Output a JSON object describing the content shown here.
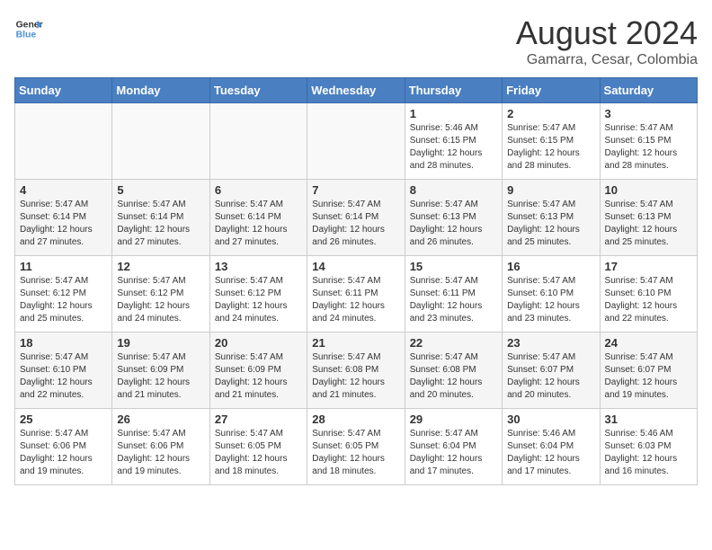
{
  "header": {
    "logo_line1": "General",
    "logo_line2": "Blue",
    "title": "August 2024",
    "subtitle": "Gamarra, Cesar, Colombia"
  },
  "weekdays": [
    "Sunday",
    "Monday",
    "Tuesday",
    "Wednesday",
    "Thursday",
    "Friday",
    "Saturday"
  ],
  "weeks": [
    [
      {
        "day": "",
        "detail": ""
      },
      {
        "day": "",
        "detail": ""
      },
      {
        "day": "",
        "detail": ""
      },
      {
        "day": "",
        "detail": ""
      },
      {
        "day": "1",
        "detail": "Sunrise: 5:46 AM\nSunset: 6:15 PM\nDaylight: 12 hours\nand 28 minutes."
      },
      {
        "day": "2",
        "detail": "Sunrise: 5:47 AM\nSunset: 6:15 PM\nDaylight: 12 hours\nand 28 minutes."
      },
      {
        "day": "3",
        "detail": "Sunrise: 5:47 AM\nSunset: 6:15 PM\nDaylight: 12 hours\nand 28 minutes."
      }
    ],
    [
      {
        "day": "4",
        "detail": "Sunrise: 5:47 AM\nSunset: 6:14 PM\nDaylight: 12 hours\nand 27 minutes."
      },
      {
        "day": "5",
        "detail": "Sunrise: 5:47 AM\nSunset: 6:14 PM\nDaylight: 12 hours\nand 27 minutes."
      },
      {
        "day": "6",
        "detail": "Sunrise: 5:47 AM\nSunset: 6:14 PM\nDaylight: 12 hours\nand 27 minutes."
      },
      {
        "day": "7",
        "detail": "Sunrise: 5:47 AM\nSunset: 6:14 PM\nDaylight: 12 hours\nand 26 minutes."
      },
      {
        "day": "8",
        "detail": "Sunrise: 5:47 AM\nSunset: 6:13 PM\nDaylight: 12 hours\nand 26 minutes."
      },
      {
        "day": "9",
        "detail": "Sunrise: 5:47 AM\nSunset: 6:13 PM\nDaylight: 12 hours\nand 25 minutes."
      },
      {
        "day": "10",
        "detail": "Sunrise: 5:47 AM\nSunset: 6:13 PM\nDaylight: 12 hours\nand 25 minutes."
      }
    ],
    [
      {
        "day": "11",
        "detail": "Sunrise: 5:47 AM\nSunset: 6:12 PM\nDaylight: 12 hours\nand 25 minutes."
      },
      {
        "day": "12",
        "detail": "Sunrise: 5:47 AM\nSunset: 6:12 PM\nDaylight: 12 hours\nand 24 minutes."
      },
      {
        "day": "13",
        "detail": "Sunrise: 5:47 AM\nSunset: 6:12 PM\nDaylight: 12 hours\nand 24 minutes."
      },
      {
        "day": "14",
        "detail": "Sunrise: 5:47 AM\nSunset: 6:11 PM\nDaylight: 12 hours\nand 24 minutes."
      },
      {
        "day": "15",
        "detail": "Sunrise: 5:47 AM\nSunset: 6:11 PM\nDaylight: 12 hours\nand 23 minutes."
      },
      {
        "day": "16",
        "detail": "Sunrise: 5:47 AM\nSunset: 6:10 PM\nDaylight: 12 hours\nand 23 minutes."
      },
      {
        "day": "17",
        "detail": "Sunrise: 5:47 AM\nSunset: 6:10 PM\nDaylight: 12 hours\nand 22 minutes."
      }
    ],
    [
      {
        "day": "18",
        "detail": "Sunrise: 5:47 AM\nSunset: 6:10 PM\nDaylight: 12 hours\nand 22 minutes."
      },
      {
        "day": "19",
        "detail": "Sunrise: 5:47 AM\nSunset: 6:09 PM\nDaylight: 12 hours\nand 21 minutes."
      },
      {
        "day": "20",
        "detail": "Sunrise: 5:47 AM\nSunset: 6:09 PM\nDaylight: 12 hours\nand 21 minutes."
      },
      {
        "day": "21",
        "detail": "Sunrise: 5:47 AM\nSunset: 6:08 PM\nDaylight: 12 hours\nand 21 minutes."
      },
      {
        "day": "22",
        "detail": "Sunrise: 5:47 AM\nSunset: 6:08 PM\nDaylight: 12 hours\nand 20 minutes."
      },
      {
        "day": "23",
        "detail": "Sunrise: 5:47 AM\nSunset: 6:07 PM\nDaylight: 12 hours\nand 20 minutes."
      },
      {
        "day": "24",
        "detail": "Sunrise: 5:47 AM\nSunset: 6:07 PM\nDaylight: 12 hours\nand 19 minutes."
      }
    ],
    [
      {
        "day": "25",
        "detail": "Sunrise: 5:47 AM\nSunset: 6:06 PM\nDaylight: 12 hours\nand 19 minutes."
      },
      {
        "day": "26",
        "detail": "Sunrise: 5:47 AM\nSunset: 6:06 PM\nDaylight: 12 hours\nand 19 minutes."
      },
      {
        "day": "27",
        "detail": "Sunrise: 5:47 AM\nSunset: 6:05 PM\nDaylight: 12 hours\nand 18 minutes."
      },
      {
        "day": "28",
        "detail": "Sunrise: 5:47 AM\nSunset: 6:05 PM\nDaylight: 12 hours\nand 18 minutes."
      },
      {
        "day": "29",
        "detail": "Sunrise: 5:47 AM\nSunset: 6:04 PM\nDaylight: 12 hours\nand 17 minutes."
      },
      {
        "day": "30",
        "detail": "Sunrise: 5:46 AM\nSunset: 6:04 PM\nDaylight: 12 hours\nand 17 minutes."
      },
      {
        "day": "31",
        "detail": "Sunrise: 5:46 AM\nSunset: 6:03 PM\nDaylight: 12 hours\nand 16 minutes."
      }
    ]
  ]
}
